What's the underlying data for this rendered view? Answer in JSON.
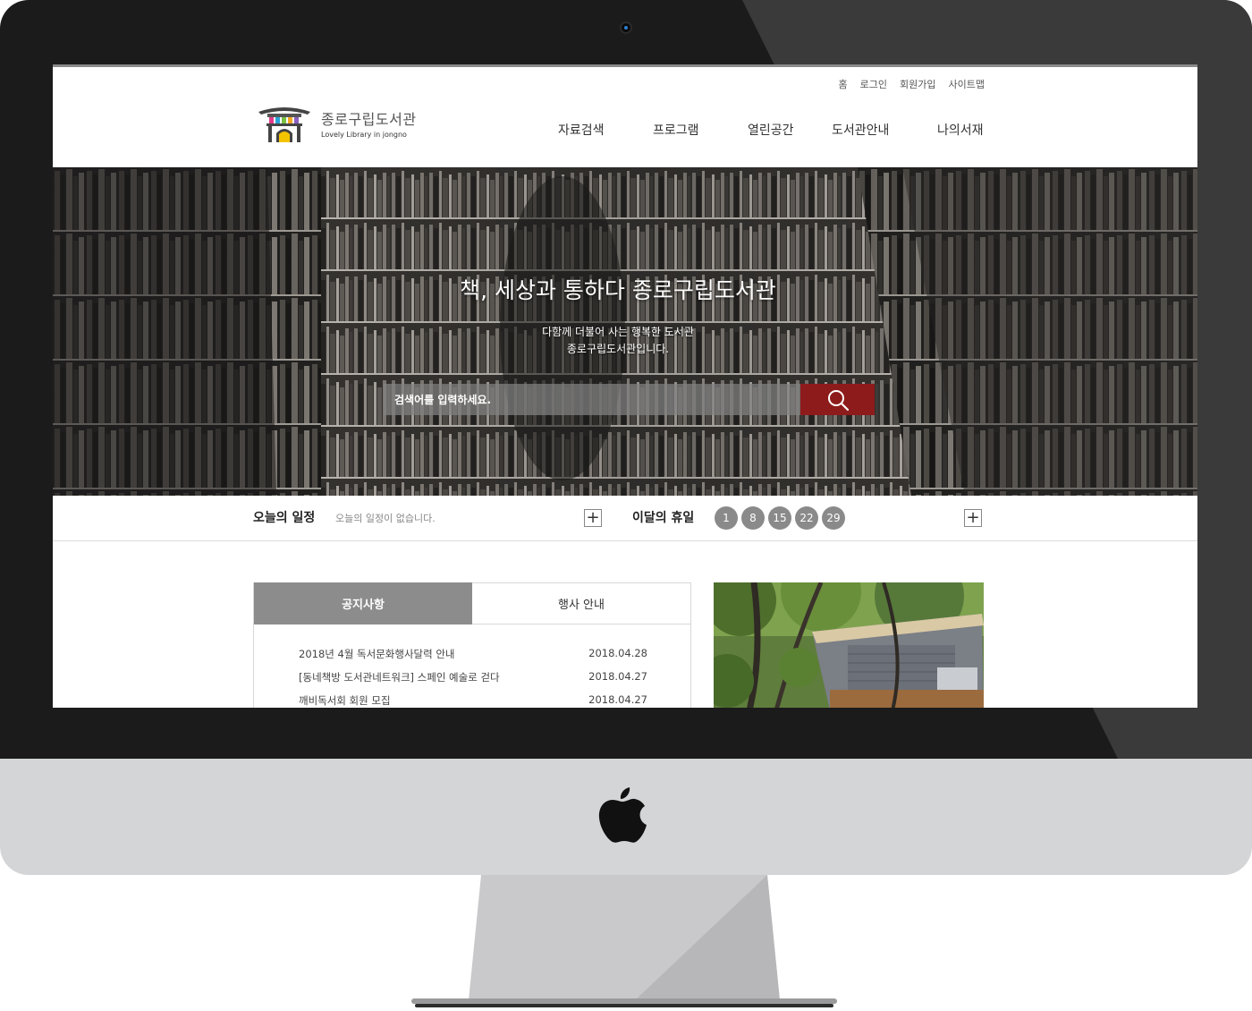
{
  "utility_nav": [
    "홈",
    "로그인",
    "회원가입",
    "사이트맵"
  ],
  "logo": {
    "title": "종로구립도서관",
    "subtitle": "Lovely Library in jongno"
  },
  "main_nav": [
    "자료검색",
    "프로그램",
    "열린공간",
    "도서관안내",
    "나의서재"
  ],
  "hero": {
    "title": "책, 세상과 통하다 종로구립도서관",
    "desc_line1": "다함께 더불어 사는 행복한 도서관",
    "desc_line2": "종로구립도서관입니다.",
    "search_placeholder": "검색어를 입력하세요."
  },
  "info_bar": {
    "today_label": "오늘의 일정",
    "today_text": "오늘의 일정이 없습니다.",
    "holiday_label": "이달의 휴일",
    "holidays": [
      "1",
      "8",
      "15",
      "22",
      "29"
    ],
    "more_symbol": "+"
  },
  "board": {
    "tabs": [
      "공지사항",
      "행사 안내"
    ],
    "notices": [
      {
        "title": "2018년 4월 독서문화행사달력 안내",
        "date": "2018.04.28"
      },
      {
        "title": "[동네책방 도서관네트워크] 스페인 예술로 걷다",
        "date": "2018.04.27"
      },
      {
        "title": "깨비독서회 회원 모집",
        "date": "2018.04.27"
      }
    ]
  },
  "colors": {
    "accent_red": "#8e1b1b",
    "tab_gray": "#8c8c8c",
    "holiday_gray": "#8a8a8a"
  }
}
